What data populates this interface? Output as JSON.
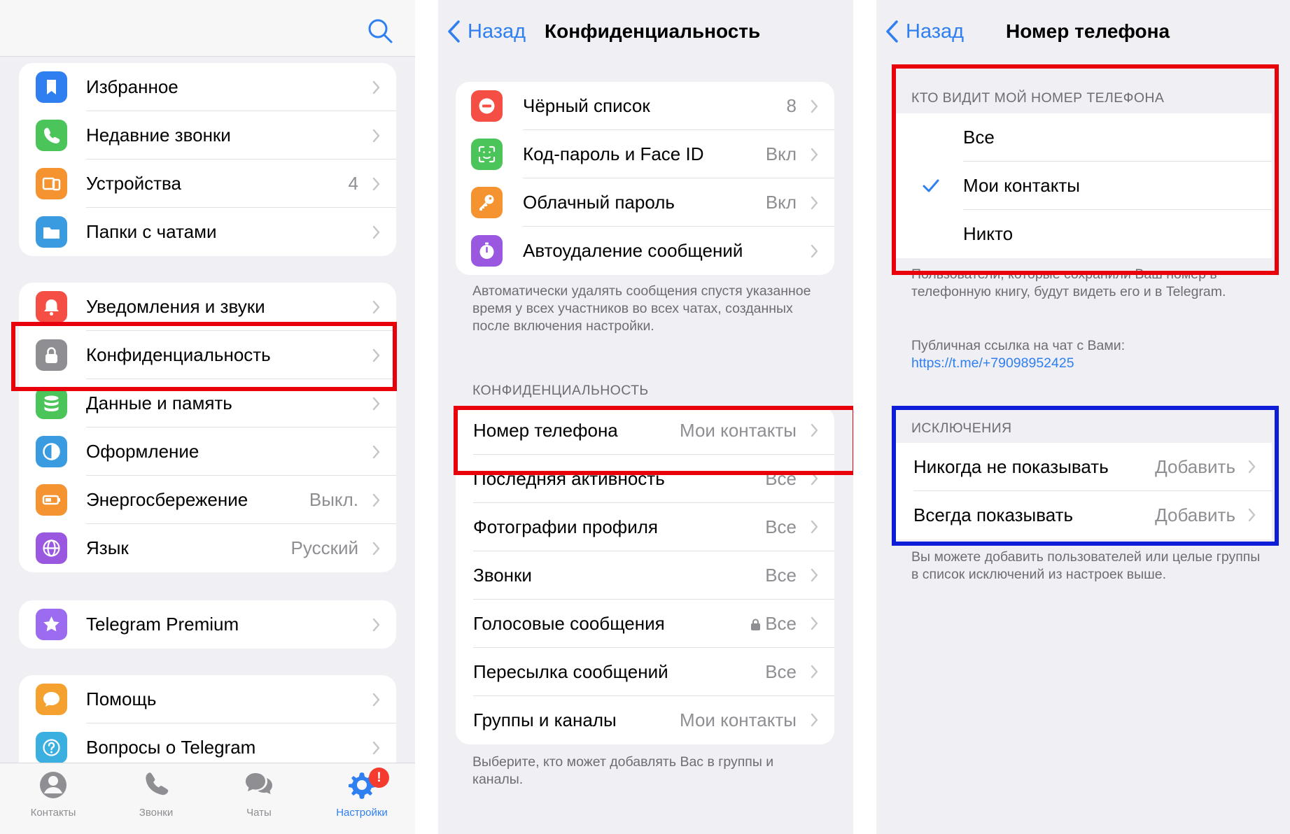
{
  "panel1": {
    "group1": [
      {
        "label": "Избранное",
        "value": "",
        "icon": "bookmark-icon",
        "color": "#2f7ff1"
      },
      {
        "label": "Недавние звонки",
        "value": "",
        "icon": "phone-icon",
        "color": "#4bc45a"
      },
      {
        "label": "Устройства",
        "value": "4",
        "icon": "devices-icon",
        "color": "#f4932f"
      },
      {
        "label": "Папки с чатами",
        "value": "",
        "icon": "folder-icon",
        "color": "#3b9be0"
      }
    ],
    "group2": [
      {
        "label": "Уведомления и звуки",
        "value": "",
        "icon": "bell-icon",
        "color": "#f54f45"
      },
      {
        "label": "Конфиденциальность",
        "value": "",
        "icon": "lock-icon",
        "color": "#8e8e93"
      },
      {
        "label": "Данные и память",
        "value": "",
        "icon": "database-icon",
        "color": "#4bc45a"
      },
      {
        "label": "Оформление",
        "value": "",
        "icon": "halfcircle-icon",
        "color": "#3b9be0"
      },
      {
        "label": "Энергосбережение",
        "value": "Выкл.",
        "icon": "battery-icon",
        "color": "#f4932f"
      },
      {
        "label": "Язык",
        "value": "Русский",
        "icon": "globe-icon",
        "color": "#9a58e0"
      }
    ],
    "group3": [
      {
        "label": "Telegram Premium",
        "value": "",
        "icon": "star-icon",
        "color": "#9b6cf0"
      }
    ],
    "group4": [
      {
        "label": "Помощь",
        "value": "",
        "icon": "chat-bubble-icon",
        "color": "#f4a12f"
      },
      {
        "label": "Вопросы о Telegram",
        "value": "",
        "icon": "question-icon",
        "color": "#3bb0e0"
      }
    ],
    "tabs": [
      {
        "label": "Контакты",
        "icon": "person-icon",
        "active": false
      },
      {
        "label": "Звонки",
        "icon": "phone-icon",
        "active": false
      },
      {
        "label": "Чаты",
        "icon": "chats-icon",
        "active": false
      },
      {
        "label": "Настройки",
        "icon": "gear-icon",
        "active": true,
        "badge": "!"
      }
    ]
  },
  "panel2": {
    "back": "Назад",
    "title": "Конфиденциальность",
    "group1": [
      {
        "label": "Чёрный список",
        "value": "8",
        "icon": "block-icon",
        "color": "#f54f45"
      },
      {
        "label": "Код-пароль и Face ID",
        "value": "Вкл",
        "icon": "faceid-icon",
        "color": "#4bc45a"
      },
      {
        "label": "Облачный пароль",
        "value": "Вкл",
        "icon": "key-icon",
        "color": "#f4932f"
      },
      {
        "label": "Автоудаление сообщений",
        "value": "",
        "icon": "timer-icon",
        "color": "#9a58e0"
      }
    ],
    "footnote1": "Автоматически удалять сообщения спустя указанное время у всех участников во всех чатах, созданных после включения настройки.",
    "section": "КОНФИДЕНЦИАЛЬНОСТЬ",
    "group2": [
      {
        "label": "Номер телефона",
        "value": "Мои контакты"
      },
      {
        "label": "Последняя активность",
        "value": "Все"
      },
      {
        "label": "Фотографии профиля",
        "value": "Все"
      },
      {
        "label": "Звонки",
        "value": "Все"
      },
      {
        "label": "Голосовые сообщения",
        "value": "Все",
        "locked": true
      },
      {
        "label": "Пересылка сообщений",
        "value": "Все"
      },
      {
        "label": "Группы и каналы",
        "value": "Мои контакты"
      }
    ],
    "footnote2": "Выберите, кто может добавлять Вас в группы и каналы."
  },
  "panel3": {
    "back": "Назад",
    "title": "Номер телефона",
    "section1": "КТО ВИДИТ МОЙ НОМЕР ТЕЛЕФОНА",
    "options": [
      {
        "label": "Все",
        "checked": false
      },
      {
        "label": "Мои контакты",
        "checked": true
      },
      {
        "label": "Никто",
        "checked": false
      }
    ],
    "footnote1": "Пользователи, которые сохранили Ваш номер в телефонную книгу, будут видеть его и в Telegram.",
    "public_link_label": "Публичная ссылка на чат с Вами:",
    "public_link": "https://t.me/+79098952425",
    "section2": "ИСКЛЮЧЕНИЯ",
    "exceptions": [
      {
        "label": "Никогда не показывать",
        "value": "Добавить"
      },
      {
        "label": "Всегда показывать",
        "value": "Добавить"
      }
    ],
    "footnote2": "Вы можете добавить пользователей или целые группы в список исключений из настроек выше."
  }
}
